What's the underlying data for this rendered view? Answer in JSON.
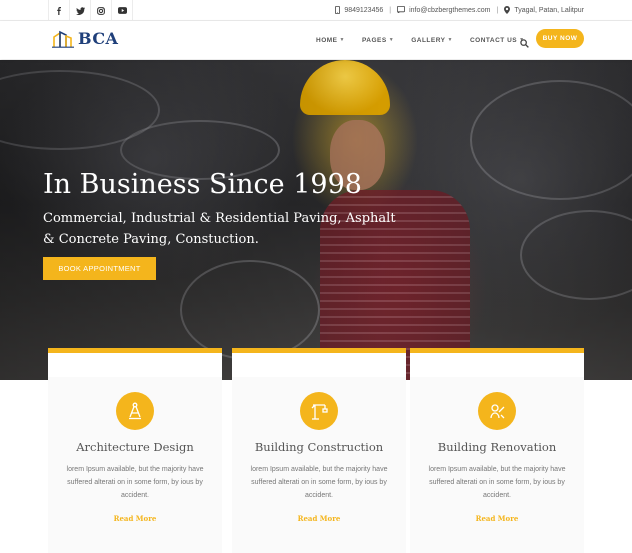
{
  "topbar": {
    "social": [
      "facebook-icon",
      "twitter-icon",
      "instagram-icon",
      "youtube-icon"
    ],
    "phone": "9849123456",
    "email": "info@cbzbergthemes.com",
    "address": "Tyagal, Patan, Lalitpur"
  },
  "nav": {
    "logo_text": "BCA",
    "items": [
      "HOME",
      "PAGES",
      "GALLERY",
      "CONTACT US"
    ],
    "buy_label": "BUY NOW"
  },
  "hero": {
    "title": "In Business Since 1998",
    "subtitle": "Commercial, Industrial & Residential Paving, Asphalt & Concrete Paving, Constuction.",
    "cta": "BOOK APPOINTMENT"
  },
  "services": [
    {
      "icon": "compass-icon",
      "title": "Architecture Design",
      "text": "lorem Ipsum available, but the majority have suffered alterati on in some form, by ious by accident.",
      "link": "Read More"
    },
    {
      "icon": "crane-icon",
      "title": "Building Construction",
      "text": "lorem Ipsum available, but the majority have suffered alterati on in some form, by ious by accident.",
      "link": "Read More"
    },
    {
      "icon": "renovation-icon",
      "title": "Building Renovation",
      "text": "lorem Ipsum available, but the majority have suffered alterati on in some form, by ious by accident.",
      "link": "Read More"
    }
  ],
  "colors": {
    "accent": "#f4b51c",
    "logo": "#1f3f7a"
  }
}
